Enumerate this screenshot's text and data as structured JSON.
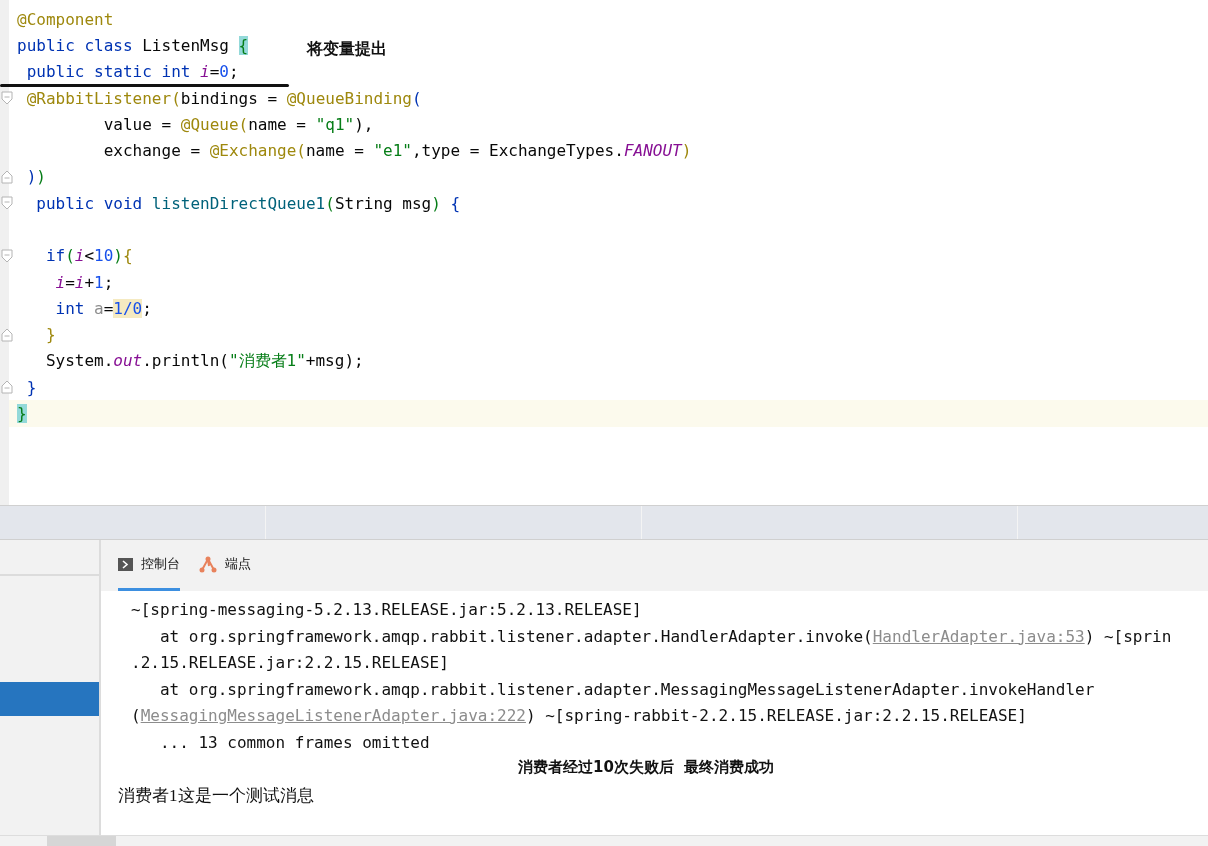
{
  "editor": {
    "lines": [
      {
        "kind": "plain",
        "current": false,
        "tokens": [
          {
            "kind": "annotation",
            "text": "@Component"
          }
        ]
      },
      {
        "kind": "plain",
        "current": false,
        "tokens": [
          {
            "kind": "keyword",
            "text": "public class "
          },
          {
            "kind": "plain",
            "text": "ListenMsg "
          },
          {
            "kind": "brace-match",
            "text": "{"
          }
        ]
      },
      {
        "kind": "plain",
        "current": false,
        "tokens": [
          {
            "kind": "keyword",
            "text": " public static int "
          },
          {
            "kind": "field",
            "text": "i"
          },
          {
            "kind": "plain",
            "text": "="
          },
          {
            "kind": "number",
            "text": "0"
          },
          {
            "kind": "plain",
            "text": ";"
          }
        ]
      },
      {
        "kind": "fold-start",
        "current": false,
        "tokens": [
          {
            "kind": "annotation",
            "text": " @RabbitListener("
          },
          {
            "kind": "plain",
            "text": "bindings = "
          },
          {
            "kind": "annotation",
            "text": "@QueueBinding"
          },
          {
            "kind": "keyword",
            "text": "("
          }
        ]
      },
      {
        "kind": "plain",
        "current": false,
        "tokens": [
          {
            "kind": "plain",
            "text": "         value = "
          },
          {
            "kind": "annotation",
            "text": "@Queue("
          },
          {
            "kind": "plain",
            "text": "name = "
          },
          {
            "kind": "string",
            "text": "\"q1\""
          },
          {
            "kind": "plain",
            "text": "),"
          }
        ]
      },
      {
        "kind": "plain",
        "current": false,
        "tokens": [
          {
            "kind": "plain",
            "text": "         exchange = "
          },
          {
            "kind": "annotation",
            "text": "@Exchange("
          },
          {
            "kind": "plain",
            "text": "name = "
          },
          {
            "kind": "string",
            "text": "\"e1\""
          },
          {
            "kind": "plain",
            "text": ",type = ExchangeTypes."
          },
          {
            "kind": "field",
            "text": "FANOUT"
          },
          {
            "kind": "annotation",
            "text": ")"
          }
        ]
      },
      {
        "kind": "fold-end",
        "current": false,
        "tokens": [
          {
            "kind": "keyword",
            "text": " )"
          },
          {
            "kind": "string",
            "text": ")"
          }
        ]
      },
      {
        "kind": "fold-start",
        "current": false,
        "tokens": [
          {
            "kind": "keyword",
            "text": "  public void "
          },
          {
            "kind": "method",
            "text": "listenDirectQueue1"
          },
          {
            "kind": "string",
            "text": "("
          },
          {
            "kind": "plain",
            "text": "String msg"
          },
          {
            "kind": "string",
            "text": ") "
          },
          {
            "kind": "keyword",
            "text": "{"
          }
        ]
      },
      {
        "kind": "plain",
        "current": false
      },
      {
        "kind": "fold-start",
        "current": false,
        "tokens": [
          {
            "kind": "keyword",
            "text": "   if"
          },
          {
            "kind": "string",
            "text": "("
          },
          {
            "kind": "field",
            "text": "i"
          },
          {
            "kind": "plain",
            "text": "<"
          },
          {
            "kind": "number",
            "text": "10"
          },
          {
            "kind": "string",
            "text": ")"
          },
          {
            "kind": "annotation",
            "text": "{"
          }
        ]
      },
      {
        "kind": "plain",
        "current": false,
        "tokens": [
          {
            "kind": "field",
            "text": "    i"
          },
          {
            "kind": "plain",
            "text": "="
          },
          {
            "kind": "field",
            "text": "i"
          },
          {
            "kind": "plain",
            "text": "+"
          },
          {
            "kind": "number",
            "text": "1"
          },
          {
            "kind": "plain",
            "text": ";"
          }
        ]
      },
      {
        "kind": "plain",
        "current": false,
        "tokens": [
          {
            "kind": "keyword",
            "text": "    int "
          },
          {
            "kind": "unused",
            "text": "a"
          },
          {
            "kind": "plain",
            "text": "="
          },
          {
            "kind": "warning",
            "text": "1/0"
          },
          {
            "kind": "plain",
            "text": ";"
          }
        ]
      },
      {
        "kind": "fold-end",
        "current": false,
        "tokens": [
          {
            "kind": "annotation",
            "text": "   }"
          }
        ]
      },
      {
        "kind": "plain",
        "current": false,
        "tokens": [
          {
            "kind": "plain",
            "text": "   System."
          },
          {
            "kind": "field",
            "text": "out"
          },
          {
            "kind": "plain",
            "text": ".println("
          },
          {
            "kind": "string",
            "text": "\"消费者1\""
          },
          {
            "kind": "plain",
            "text": "+msg);"
          }
        ]
      },
      {
        "kind": "fold-end",
        "current": false,
        "tokens": [
          {
            "kind": "keyword",
            "text": " }"
          }
        ]
      },
      {
        "kind": "plain",
        "current": true,
        "tokens": [
          {
            "kind": "brace-match",
            "text": "}"
          }
        ]
      }
    ],
    "note": "将变量提出"
  },
  "tool_window": {
    "tabs": [
      {
        "kind": "console",
        "label": "控制台",
        "selected": true
      },
      {
        "kind": "endpoints",
        "label": "端点",
        "selected": false
      }
    ],
    "console_lines": [
      [
        {
          "kind": "text",
          "text": "~[spring-messaging-5.2.13.RELEASE.jar:5.2.13.RELEASE]"
        }
      ],
      [
        {
          "kind": "text",
          "text": "   at org.springframework.amqp.rabbit.listener.adapter.HandlerAdapter.invoke("
        },
        {
          "kind": "link",
          "text": "HandlerAdapter.java:53"
        },
        {
          "kind": "text",
          "text": ") ~[sprin"
        }
      ],
      [
        {
          "kind": "text",
          "text": ".2.15.RELEASE.jar:2.2.15.RELEASE]"
        }
      ],
      [
        {
          "kind": "text",
          "text": "   at org.springframework.amqp.rabbit.listener.adapter.MessagingMessageListenerAdapter.invokeHandler"
        }
      ],
      [
        {
          "kind": "text",
          "text": "("
        },
        {
          "kind": "link",
          "text": "MessagingMessageListenerAdapter.java:222"
        },
        {
          "kind": "text",
          "text": ") ~[spring-rabbit-2.2.15.RELEASE.jar:2.2.15.RELEASE]"
        }
      ],
      [
        {
          "kind": "text",
          "text": "   ... 13 common frames omitted"
        }
      ]
    ],
    "note": "消费者经过10次失败后  最终消费成功",
    "output": "消费者1这是一个测试消息"
  }
}
